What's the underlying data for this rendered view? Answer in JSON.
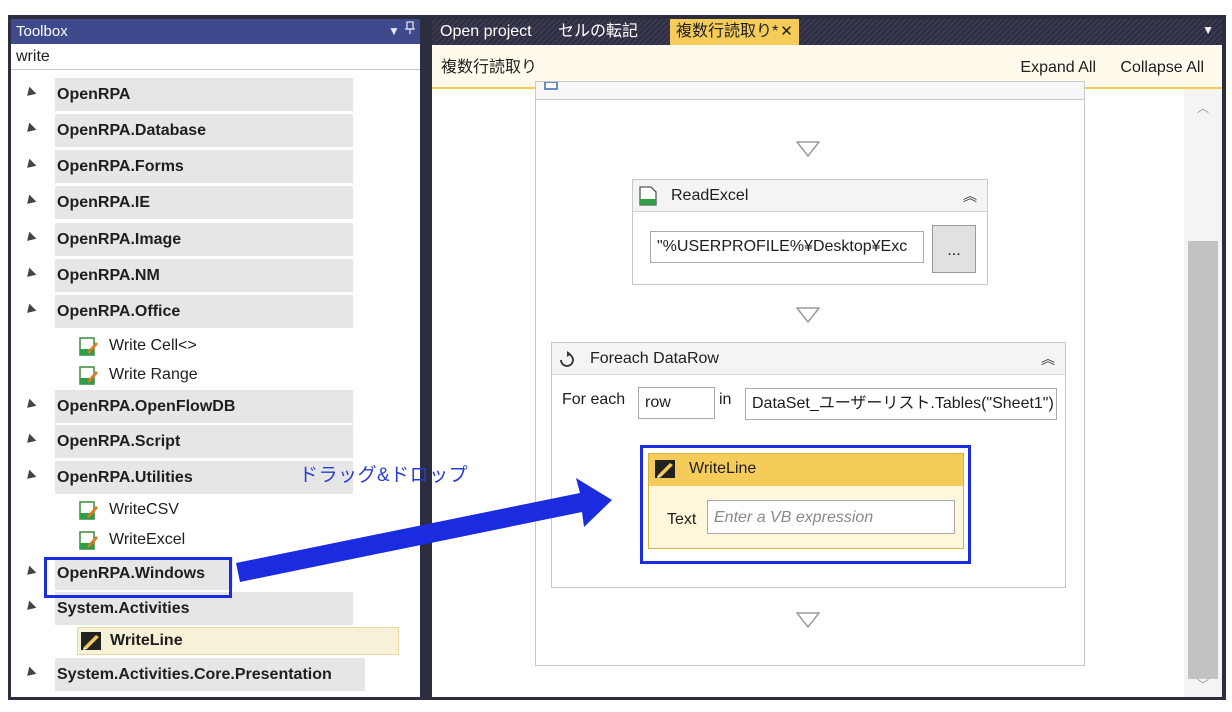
{
  "toolbox": {
    "title": "Toolbox",
    "pin_icon": "pin-icon",
    "dropdown_icon": "dropdown-icon",
    "search_value": "write",
    "categories": [
      {
        "label": "OpenRPA"
      },
      {
        "label": "OpenRPA.Database"
      },
      {
        "label": "OpenRPA.Forms"
      },
      {
        "label": "OpenRPA.IE"
      },
      {
        "label": "OpenRPA.Image"
      },
      {
        "label": "OpenRPA.NM"
      },
      {
        "label": "OpenRPA.Office"
      },
      {
        "label": "OpenRPA.OpenFlowDB"
      },
      {
        "label": "OpenRPA.Script"
      },
      {
        "label": "OpenRPA.Utilities"
      },
      {
        "label": "OpenRPA.Windows"
      },
      {
        "label": "System.Activities"
      },
      {
        "label": "System.Activities.Core.Presentation"
      }
    ],
    "office_items": [
      "Write Cell<>",
      "Write Range"
    ],
    "utilities_items": [
      "WriteCSV",
      "WriteExcel"
    ],
    "system_items": [
      "WriteLine"
    ]
  },
  "tabs": [
    {
      "label": "Open project"
    },
    {
      "label": "セルの転記"
    },
    {
      "label": "複数行読取り*",
      "close": "✕"
    }
  ],
  "designer": {
    "title": "複数行読取り",
    "expand_all": "Expand All",
    "collapse_all": "Collapse All",
    "read_excel": {
      "name": "ReadExcel",
      "filename": "\"%USERPROFILE%¥Desktop¥Exc",
      "browse_label": "..."
    },
    "foreach": {
      "name": "Foreach DataRow",
      "for_each_label": "For each",
      "variable": "row",
      "in_label": "in",
      "collection": "DataSet_ユーザーリスト.Tables(\"Sheet1\")"
    },
    "writeline": {
      "name": "WriteLine",
      "text_label": "Text",
      "text_placeholder": "Enter a VB expression"
    }
  },
  "annotation": {
    "drag_drop_label": "ドラッグ&ドロップ",
    "color": "#1a2be0"
  },
  "colors": {
    "accent": "#f5cc5a",
    "toolbox_header": "#3e4a8c",
    "frame": "#2d2d40"
  }
}
